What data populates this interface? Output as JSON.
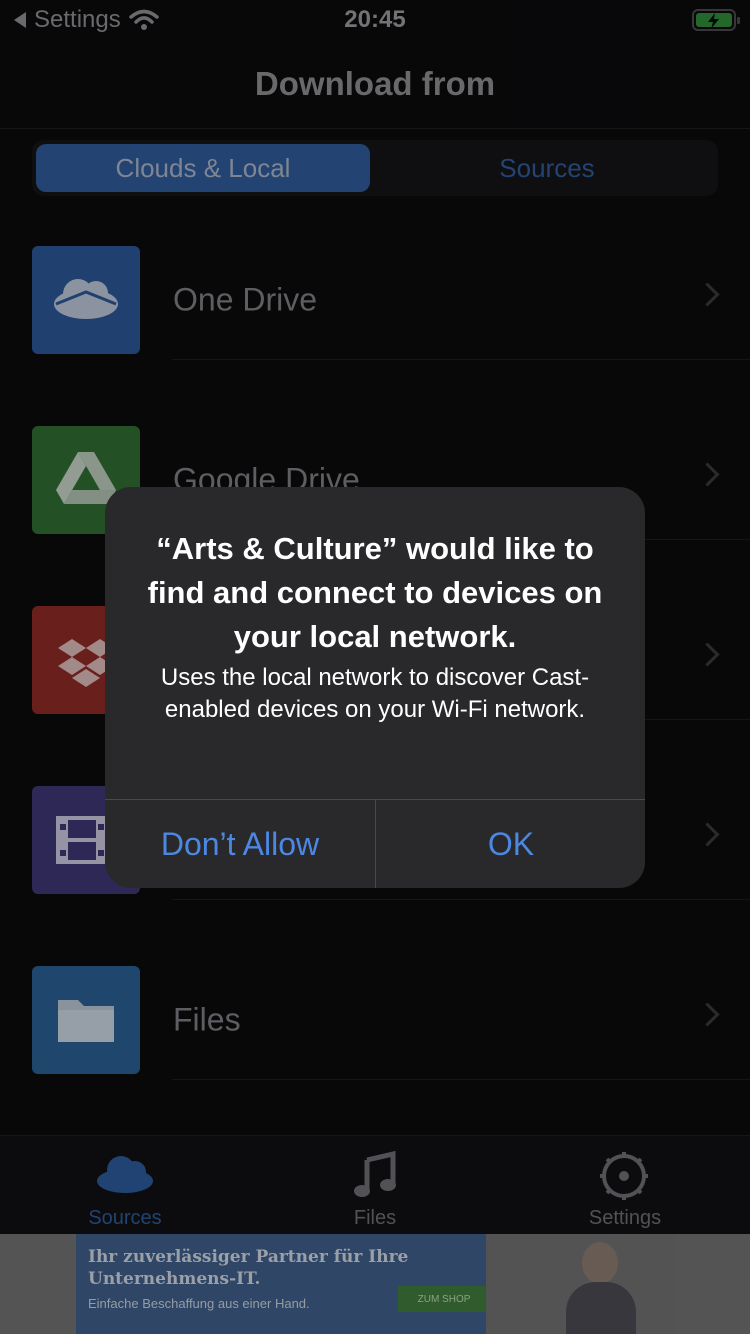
{
  "status_bar": {
    "back_label": "Settings",
    "time": "20:45"
  },
  "nav": {
    "title": "Download from"
  },
  "segments": {
    "clouds_local": "Clouds & Local",
    "sources": "Sources"
  },
  "rows": [
    {
      "label": "One Drive",
      "icon": "onedrive-icon",
      "color": "#2b5694"
    },
    {
      "label": "Google Drive",
      "icon": "google-drive-icon",
      "color": "#2f6b32"
    },
    {
      "label": "",
      "icon": "dropbox-icon",
      "color": "#8c2b27"
    },
    {
      "label": "",
      "icon": "film-icon",
      "color": "#3e3675"
    },
    {
      "label": "Files",
      "icon": "folder-icon",
      "color": "#2a5f92"
    }
  ],
  "tabs": [
    {
      "label": "Sources",
      "icon": "cloud-icon",
      "active": true
    },
    {
      "label": "Files",
      "icon": "music-note-icon",
      "active": false
    },
    {
      "label": "Settings",
      "icon": "gear-icon",
      "active": false
    }
  ],
  "ad": {
    "headline": "Ihr zuverlässiger Partner für Ihre Unternehmens-IT.",
    "subline": "Einfache Beschaffung aus einer Hand.",
    "cta": "ZUM SHOP"
  },
  "alert": {
    "title": "“Arts & Culture” would like to find and connect to devices on your local network.",
    "message": "Uses the local network to discover Cast-enabled devices on your Wi-Fi network.",
    "deny_label": "Don’t Allow",
    "ok_label": "OK"
  },
  "colors": {
    "accent": "#4c87e3",
    "tab_active": "#2c5a9a",
    "background": "#0b0b0d"
  }
}
